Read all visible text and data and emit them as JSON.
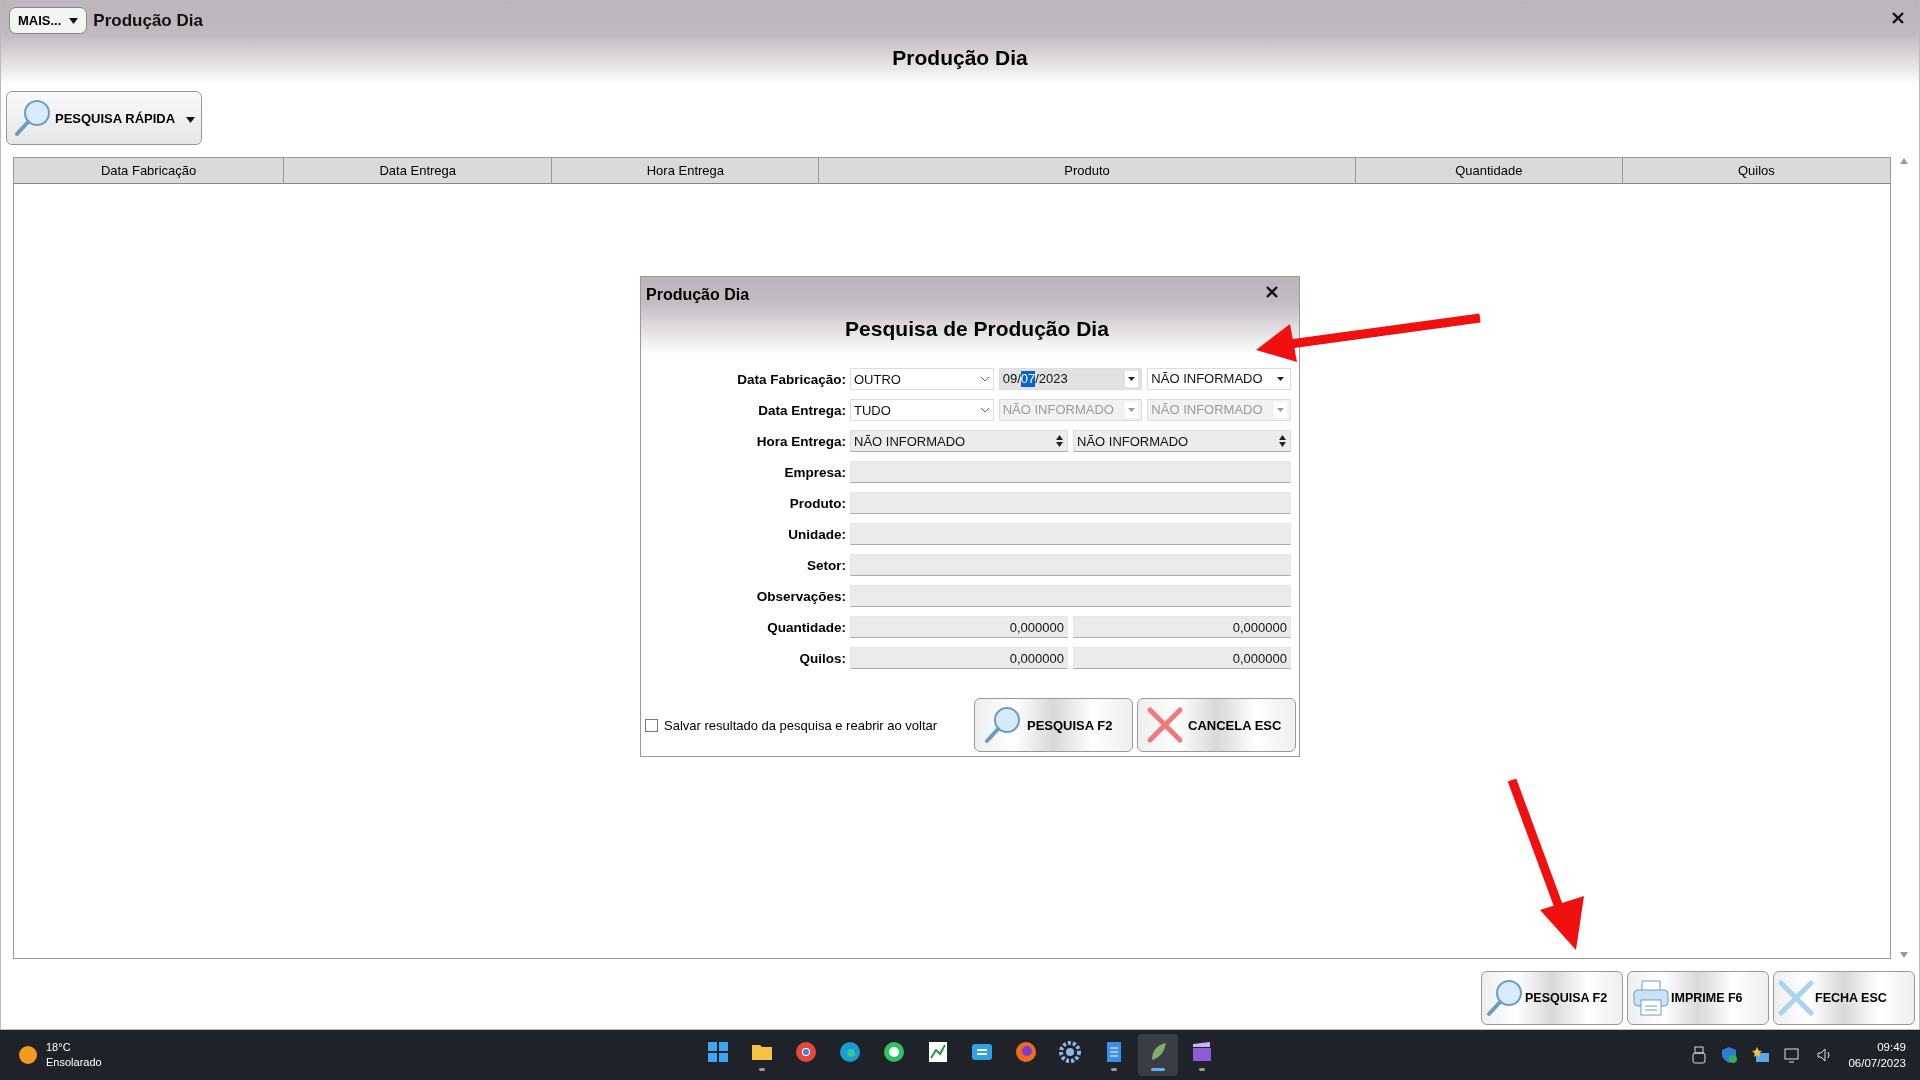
{
  "window": {
    "menu_button": "MAIS...",
    "title": "Produção Dia",
    "heading": "Produção Dia"
  },
  "quick_search": {
    "label": "PESQUISA RÁPIDA"
  },
  "table": {
    "columns": [
      "Data Fabricação",
      "Data Entrega",
      "Hora Entrega",
      "Produto",
      "Quantidade",
      "Quilos"
    ]
  },
  "footer_buttons": [
    {
      "kind": "search",
      "label": "PESQUISA F2"
    },
    {
      "kind": "print",
      "label": "IMPRIME F6"
    },
    {
      "kind": "close",
      "label": "FECHA ESC"
    }
  ],
  "dialog": {
    "title": "Produção Dia",
    "heading": "Pesquisa de Produção Dia",
    "rows": [
      {
        "label": "Data Fabricação:",
        "fields": [
          {
            "kind": "combo",
            "value": "OUTRO",
            "disabled": false
          },
          {
            "kind": "date",
            "parts": [
              {
                "text": "09/",
                "selected": false
              },
              {
                "text": "07",
                "selected": true
              },
              {
                "text": "/2023",
                "selected": false
              }
            ],
            "disabled": false
          },
          {
            "kind": "date",
            "parts": [
              {
                "text": "NÃO INFORMADO",
                "selected": false
              }
            ],
            "disabled": false
          }
        ]
      },
      {
        "label": "Data Entrega:",
        "fields": [
          {
            "kind": "combo",
            "value": "TUDO",
            "disabled": false
          },
          {
            "kind": "date",
            "parts": [
              {
                "text": "NÃO INFORMADO",
                "selected": false
              }
            ],
            "disabled": true
          },
          {
            "kind": "date",
            "parts": [
              {
                "text": "NÃO INFORMADO",
                "selected": false
              }
            ],
            "disabled": true
          }
        ]
      },
      {
        "label": "Hora Entrega:",
        "fields": [
          {
            "kind": "spin",
            "value": "NÃO INFORMADO",
            "disabled": false
          },
          {
            "kind": "spin",
            "value": "NÃO INFORMADO",
            "disabled": false
          }
        ]
      },
      {
        "label": "Empresa:",
        "fields": [
          {
            "kind": "text"
          }
        ]
      },
      {
        "label": "Produto:",
        "fields": [
          {
            "kind": "text"
          }
        ]
      },
      {
        "label": "Unidade:",
        "fields": [
          {
            "kind": "text"
          }
        ]
      },
      {
        "label": "Setor:",
        "fields": [
          {
            "kind": "text"
          }
        ]
      },
      {
        "label": "Observações:",
        "fields": [
          {
            "kind": "text"
          }
        ]
      },
      {
        "label": "Quantidade:",
        "fields": [
          {
            "kind": "number",
            "value": "0,000000"
          },
          {
            "kind": "number",
            "value": "0,000000"
          }
        ]
      },
      {
        "label": "Quilos:",
        "fields": [
          {
            "kind": "number",
            "value": "0,000000"
          },
          {
            "kind": "number",
            "value": "0,000000"
          }
        ]
      }
    ],
    "save_option": {
      "label": "Salvar resultado da pesquisa e reabrir ao voltar",
      "checked": false
    },
    "buttons": [
      {
        "kind": "search",
        "label": "PESQUISA F2"
      },
      {
        "kind": "cancel",
        "label": "CANCELA ESC"
      }
    ]
  },
  "taskbar": {
    "weather": {
      "temperature": "18°C",
      "condition": "Ensolarado"
    },
    "apps": [
      {
        "kind": "start",
        "open": false,
        "active": false
      },
      {
        "kind": "folder",
        "open": true,
        "active": false
      },
      {
        "kind": "chrome",
        "open": false,
        "active": false
      },
      {
        "kind": "edge",
        "open": false,
        "active": false
      },
      {
        "kind": "chat",
        "open": false,
        "active": false
      },
      {
        "kind": "sheet",
        "open": false,
        "active": false
      },
      {
        "kind": "sync",
        "open": false,
        "active": false
      },
      {
        "kind": "firefox",
        "open": false,
        "active": false
      },
      {
        "kind": "gear",
        "open": false,
        "active": false
      },
      {
        "kind": "notepad",
        "open": true,
        "active": false
      },
      {
        "kind": "leaf",
        "open": true,
        "active": true
      },
      {
        "kind": "clapper",
        "open": true,
        "active": false
      }
    ],
    "time": "09:49",
    "date": "06/07/2023"
  }
}
